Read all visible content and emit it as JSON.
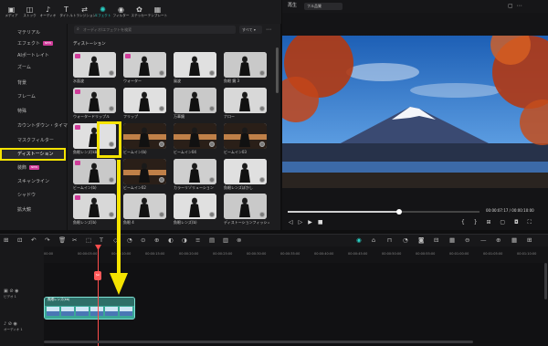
{
  "toolbar": {
    "items": [
      {
        "label": "メディア",
        "icon": "media-icon",
        "glyph": "▣"
      },
      {
        "label": "ストック",
        "icon": "stock-icon",
        "glyph": "◫"
      },
      {
        "label": "オーディオ",
        "icon": "audio-icon",
        "glyph": "♪"
      },
      {
        "label": "タイトル",
        "icon": "title-icon",
        "glyph": "T"
      },
      {
        "label": "トランジション",
        "icon": "transition-icon",
        "glyph": "⇄"
      },
      {
        "label": "エフェクト",
        "icon": "effect-icon",
        "glyph": "✺"
      },
      {
        "label": "フィルター",
        "icon": "filter-icon",
        "glyph": "◉"
      },
      {
        "label": "ステッカー",
        "icon": "sticker-icon",
        "glyph": "✿"
      },
      {
        "label": "テンプレート",
        "icon": "template-icon",
        "glyph": "▦"
      }
    ],
    "active_index": 5
  },
  "sidebar": {
    "items": [
      {
        "label": "マテリアル",
        "new": false
      },
      {
        "label": "エフェクト",
        "new": true
      },
      {
        "label": "AIポートレイト",
        "new": false
      },
      {
        "label": "ズーム",
        "new": false
      },
      {
        "label": "背景",
        "new": false
      },
      {
        "label": "フレーム",
        "new": false
      },
      {
        "label": "特殊",
        "new": false
      },
      {
        "label": "カウントダウン・タイマー",
        "new": false
      },
      {
        "label": "マスクフィルター",
        "new": false
      },
      {
        "label": "ディストーション",
        "new": false,
        "selected": true
      },
      {
        "label": "装飾",
        "new": true
      },
      {
        "label": "スキャンライン",
        "new": false
      },
      {
        "label": "シャドウ",
        "new": false
      },
      {
        "label": "拡大鏡",
        "new": false
      }
    ],
    "new_badge": "NEW"
  },
  "search": {
    "placeholder": "オーディオ/エフェクトを検索"
  },
  "sort": {
    "value": "すべて ▾"
  },
  "more": "⋯",
  "section_title": "ディストーション",
  "effects": [
    {
      "label": "水面波"
    },
    {
      "label": "ウォーター"
    },
    {
      "label": "風波"
    },
    {
      "label": "魚眼 鏡 3"
    },
    {
      "label": "ウォータードリップル"
    },
    {
      "label": "フリップ"
    },
    {
      "label": "万華鏡"
    },
    {
      "label": "ナロー"
    },
    {
      "label": "魚眼レンズ(kb)"
    },
    {
      "label": "ビームイン(b)"
    },
    {
      "label": "ビームイン04"
    },
    {
      "label": "ビームイン03"
    },
    {
      "label": "ビームイン(b)"
    },
    {
      "label": "ビームイン02"
    },
    {
      "label": "カラーリゾリューション"
    },
    {
      "label": "魚眼レンズぼかし"
    },
    {
      "label": "魚眼レンズ(b)"
    },
    {
      "label": "魚眼 4"
    },
    {
      "label": "魚眼レンズ(b)"
    },
    {
      "label": "ディストーションフィッシュアイ"
    }
  ],
  "preview": {
    "label": "再生",
    "quality": "フル品質",
    "time_current": "00:00:07:17",
    "time_total": "00:00:10:00",
    "progress": 0.58
  },
  "timeline": {
    "ticks": [
      "00:00",
      "00:00:05:00",
      "00:00:10:00",
      "00:00:15:00",
      "00:00:20:00",
      "00:00:25:00",
      "00:00:30:00",
      "00:00:35:00",
      "00:00:40:00",
      "00:00:45:00",
      "00:00:50:00",
      "00:00:55:00",
      "00:01:00:00",
      "00:01:05:00",
      "00:01:10:00"
    ],
    "tracks": [
      {
        "label": "ビデオ 1"
      },
      {
        "label": "オーディオ 1"
      }
    ],
    "clip_label": "魚眼レンズ(kb)"
  },
  "colors": {
    "accent": "#29d3c7",
    "highlight": "#f5e300",
    "playhead": "#ff4d4d"
  }
}
